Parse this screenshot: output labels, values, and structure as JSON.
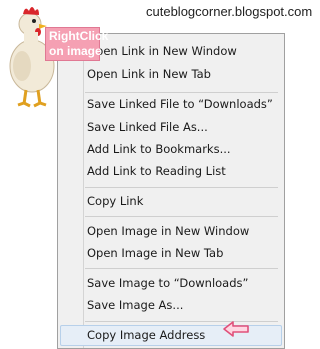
{
  "site": {
    "url": "cuteblogcorner.blogspot.com"
  },
  "callout": {
    "line1": "RightClick",
    "line2": "on image"
  },
  "menu": {
    "groups": [
      [
        "Open Link in New Window",
        "Open Link in New Tab"
      ],
      [
        "Save Linked File to “Downloads”",
        "Save Linked File As...",
        "Add Link to Bookmarks...",
        "Add Link to Reading List"
      ],
      [
        "Copy Link"
      ],
      [
        "Open Image in New Window",
        "Open Image in New Tab"
      ],
      [
        "Save Image to “Downloads”",
        "Save Image As..."
      ],
      [
        "Copy Image Address"
      ]
    ]
  },
  "colors": {
    "callout_bg": "#f5a0b3",
    "highlight": "#e6eef7",
    "arrow": "#e0507a"
  },
  "icons": [
    "chicken-mascot",
    "left-arrow-icon"
  ]
}
